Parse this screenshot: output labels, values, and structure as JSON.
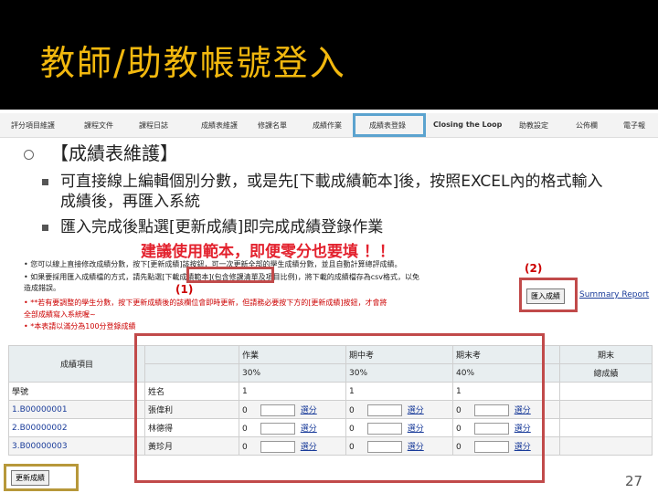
{
  "slide": {
    "title": "教師/助教帳號登入",
    "page_number": "27"
  },
  "nav": {
    "items": [
      "評分項目維護",
      "課程文件",
      "課程日誌",
      "成績表維護",
      "修課名單",
      "成績作業",
      "成績表登錄",
      "Closing the Loop",
      "助教設定",
      "公佈欄",
      "電子報"
    ]
  },
  "bullets": {
    "main": "【成績表維護】",
    "sub1": "可直接線上編輯個別分數，或是先[下載成績範本]後，按照EXCEL內的格式輸入成績後，再匯入系統",
    "sub2": "匯入完成後點選[更新成績]即完成成績登錄作業",
    "warning": "建議使用範本，即便零分也要填 ！！"
  },
  "notes": {
    "n1": "• 您可以線上直接修改成績分數，按下[更新成績]該按鈕，可一次更新全部的學生成績分數，並且自動計算總評成績。",
    "n2": "• 如果要採用匯入成績檔的方式，請先點選[下載成績範本](包含修課清單及項目比例)，將下載的成績檔存為csv格式，以免",
    "n3": "   造成錯誤。",
    "n4": "• **若有要調整的學生分數，按下更新成績後的該欄位會即時更新，但請務必要按下方的[更新成績]按鈕，才會將",
    "n5": "   全部成績寫入系統喔~",
    "n6": "• *本表請以滿分為100分登錄成績"
  },
  "labels": {
    "one": "(1)",
    "two": "(2)"
  },
  "buttons": {
    "import": "匯入成績",
    "update": "更新成績",
    "summary": "Summary Report",
    "download": "下載成績範本"
  },
  "table": {
    "header": {
      "item": "成績項目",
      "hw": "作業",
      "hw_pct": "30%",
      "mid": "期中考",
      "mid_pct": "30%",
      "fin": "期末考",
      "fin_pct": "40%",
      "total": "期末",
      "total2": "總成績"
    },
    "weight_row": {
      "label": "學號",
      "name": "姓名",
      "hw": "1",
      "mid": "1",
      "fin": "1"
    },
    "rows": [
      {
        "id": "1.B00000001",
        "name": "張偉利",
        "hw": "0",
        "mid": "0",
        "fin": "0",
        "act": "選分"
      },
      {
        "id": "2.B00000002",
        "name": "林德得",
        "hw": "0",
        "mid": "0",
        "fin": "0",
        "act": "選分"
      },
      {
        "id": "3.B00000003",
        "name": "黃珍月",
        "hw": "0",
        "mid": "0",
        "fin": "0",
        "act": "選分"
      }
    ]
  }
}
